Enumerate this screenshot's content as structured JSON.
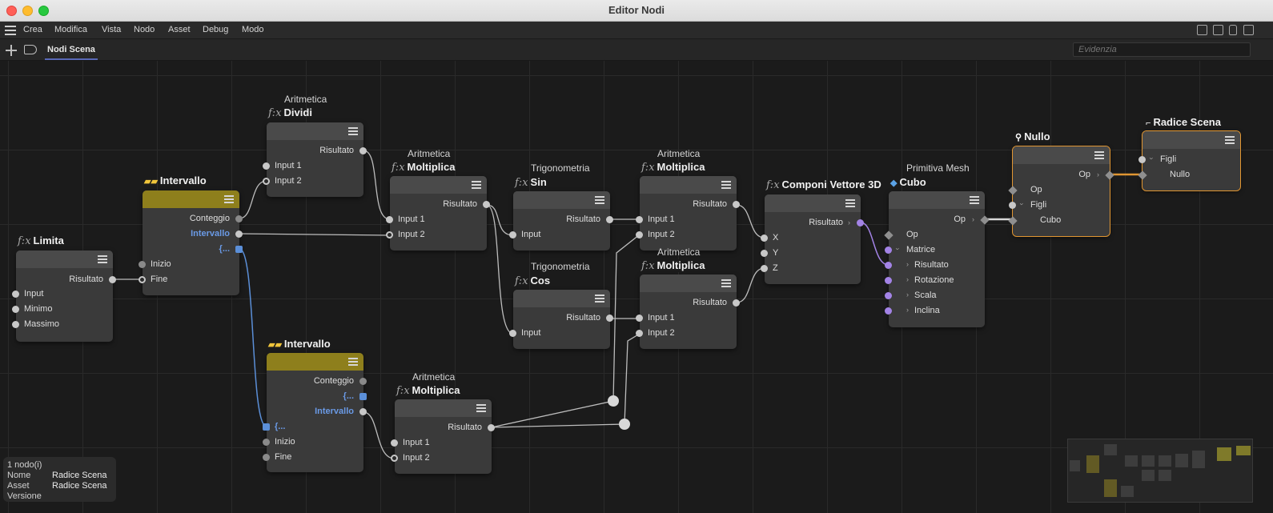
{
  "window": {
    "title": "Editor Nodi"
  },
  "menu": {
    "items": [
      "Crea",
      "Modifica",
      "Vista",
      "Nodo",
      "Asset",
      "Debug",
      "Modo"
    ]
  },
  "tabs": {
    "active": "Nodi Scena"
  },
  "search": {
    "placeholder": "Evidenzia"
  },
  "nodes": {
    "limita": {
      "title": "Limita",
      "outputs": [
        "Risultato"
      ],
      "inputs": [
        "Input",
        "Minimo",
        "Massimo"
      ]
    },
    "intervallo1": {
      "title": "Intervallo",
      "ports": [
        "Conteggio",
        "Intervallo",
        "{...",
        "Inizio",
        "Fine"
      ]
    },
    "dividi": {
      "category": "Aritmetica",
      "title": "Dividi",
      "output": "Risultato",
      "inputs": [
        "Input 1",
        "Input 2"
      ]
    },
    "moltiplica1": {
      "category": "Aritmetica",
      "title": "Moltiplica",
      "output": "Risultato",
      "inputs": [
        "Input 1",
        "Input 2"
      ]
    },
    "sin": {
      "category": "Trigonometria",
      "title": "Sin",
      "output": "Risultato",
      "inputs": [
        "Input"
      ]
    },
    "cos": {
      "category": "Trigonometria",
      "title": "Cos",
      "output": "Risultato",
      "inputs": [
        "Input"
      ]
    },
    "moltiplica2": {
      "category": "Aritmetica",
      "title": "Moltiplica",
      "output": "Risultato",
      "inputs": [
        "Input 1",
        "Input 2"
      ]
    },
    "moltiplica3": {
      "category": "Aritmetica",
      "title": "Moltiplica",
      "output": "Risultato",
      "inputs": [
        "Input 1",
        "Input 2"
      ]
    },
    "intervallo2": {
      "title": "Intervallo",
      "ports": [
        "Conteggio",
        "{...",
        "Intervallo",
        "{...",
        "Inizio",
        "Fine"
      ]
    },
    "moltiplica4": {
      "category": "Aritmetica",
      "title": "Moltiplica",
      "output": "Risultato",
      "inputs": [
        "Input 1",
        "Input 2"
      ]
    },
    "componi": {
      "title": "Componi Vettore 3D",
      "output": "Risultato",
      "inputs": [
        "X",
        "Y",
        "Z"
      ]
    },
    "cubo": {
      "category": "Primitiva Mesh",
      "title": "Cubo",
      "output": "Op",
      "inputs": [
        "Op",
        "Matrice",
        "Risultato",
        "Rotazione",
        "Scala",
        "Inclina"
      ]
    },
    "nullo": {
      "title": "Nullo",
      "output": "Op",
      "inputs": [
        "Op",
        "Figli",
        "Cubo"
      ]
    },
    "radice": {
      "title": "Radice Scena",
      "inputs": [
        "Figli",
        "Nullo"
      ]
    }
  },
  "info": {
    "count": "1 nodo(i)",
    "rows": [
      {
        "key": "Nome",
        "value": "Radice Scena"
      },
      {
        "key": "Asset",
        "value": "Radice Scena"
      },
      {
        "key": "Versione",
        "value": ""
      }
    ]
  },
  "colors": {
    "accent_tab": "#5968b7",
    "selection": "#e19632",
    "intervallo_header": "#8e7f1c",
    "wire_blue": "#5b8fd8",
    "wire_purple": "#a383e6"
  },
  "icons": [
    "hamburger-icon",
    "add-tab-icon",
    "tag-icon",
    "panel-left-icon",
    "panel-right-icon",
    "lock-icon",
    "expand-icon",
    "fx-icon",
    "intervallo-icon",
    "cube-icon",
    "null-icon",
    "scene-root-icon",
    "node-menu-icon"
  ]
}
